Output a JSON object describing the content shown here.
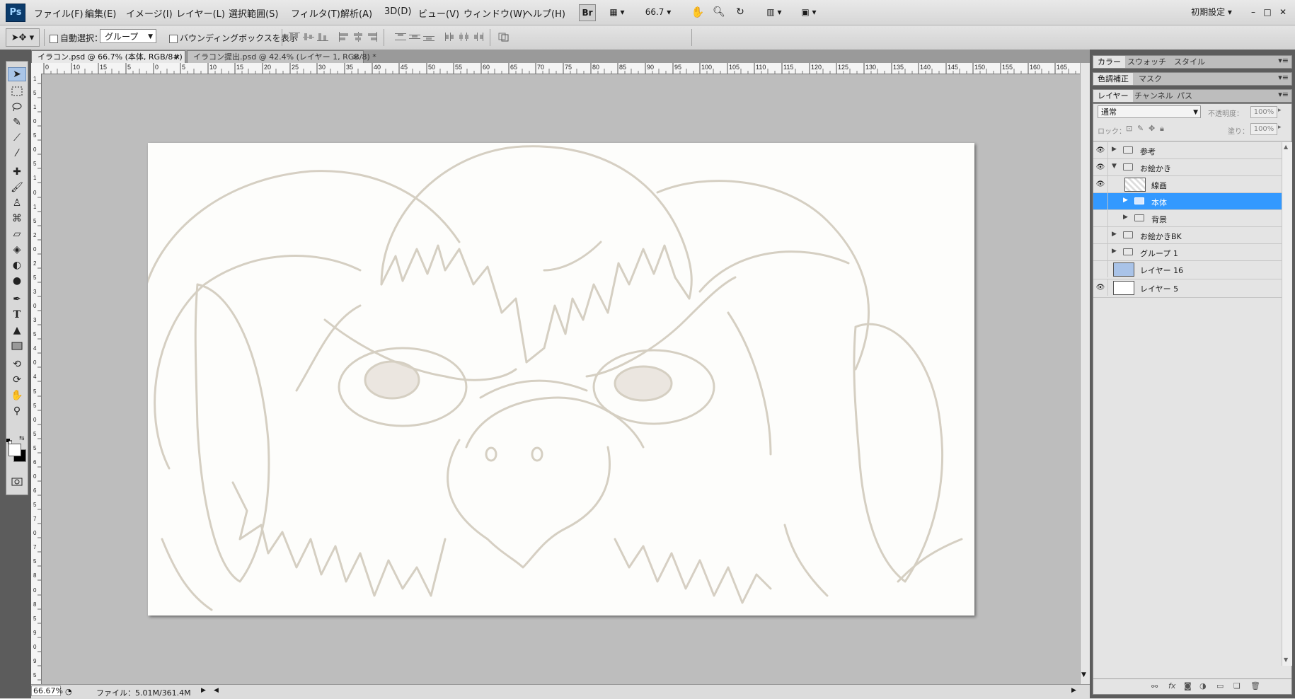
{
  "app": {
    "logo": "Ps",
    "workspace": "初期設定"
  },
  "menu": [
    "ファイル(F)",
    "編集(E)",
    "イメージ(I)",
    "レイヤー(L)",
    "選択範囲(S)",
    "フィルタ(T)",
    "解析(A)",
    "3D(D)",
    "ビュー(V)",
    "ウィンドウ(W)",
    "ヘルプ(H)"
  ],
  "appbar": {
    "bridge": "Br",
    "zoom": "66.7"
  },
  "options": {
    "auto_select": "自動選択：",
    "auto_select_value": "グループ",
    "show_bbox": "バウンディングボックスを表示"
  },
  "tabs": [
    {
      "label": "イラコン.psd @ 66.7% (本体, RGB/8#)",
      "close": "×"
    },
    {
      "label": "イラコン提出.psd @ 42.4% (レイヤー 1, RGB/8) *",
      "close": "×"
    }
  ],
  "ruler_h": [
    "0",
    "10",
    "15",
    "5",
    "0",
    "5",
    "10",
    "15",
    "20",
    "25",
    "30",
    "35",
    "40",
    "45",
    "50",
    "55",
    "60",
    "65",
    "70",
    "75",
    "80",
    "85",
    "90",
    "95",
    "100",
    "105",
    "110",
    "115",
    "120",
    "125",
    "130",
    "135",
    "140",
    "145",
    "150",
    "155",
    "160",
    "165"
  ],
  "ruler_v": [
    "1",
    "5",
    "1",
    "0",
    "5",
    "0",
    "5",
    "1",
    "0",
    "1",
    "5",
    "2",
    "0",
    "2",
    "5",
    "3",
    "0",
    "3",
    "5",
    "4",
    "0",
    "4",
    "5",
    "5",
    "0",
    "5",
    "5",
    "6",
    "0",
    "6",
    "5",
    "7",
    "0",
    "7",
    "5",
    "8",
    "0",
    "8",
    "5",
    "9",
    "0",
    "9",
    "5"
  ],
  "status": {
    "zoom": "66.67%",
    "file": "ファイル：5.01M/361.4M"
  },
  "panels": {
    "top_tabs": [
      "カラー",
      "スウォッチ",
      "スタイル"
    ],
    "adj_tabs": [
      "色調補正",
      "マスク"
    ],
    "layer_tabs": [
      "レイヤー",
      "チャンネル",
      "パス"
    ],
    "blend_mode": "通常",
    "opacity_label": "不透明度：",
    "opacity_value": "100%",
    "lock_label": "ロック：",
    "fill_label": "塗り：",
    "fill_value": "100%",
    "layers": [
      {
        "name": "参考",
        "visible": true,
        "type": "group",
        "expanded": false,
        "indent": 0
      },
      {
        "name": "お絵かき",
        "visible": true,
        "type": "group",
        "expanded": true,
        "indent": 0
      },
      {
        "name": "線画",
        "visible": true,
        "type": "layer",
        "indent": 1
      },
      {
        "name": "本体",
        "visible": false,
        "type": "group",
        "expanded": false,
        "indent": 1,
        "selected": true
      },
      {
        "name": "背景",
        "visible": false,
        "type": "group",
        "expanded": false,
        "indent": 1
      },
      {
        "name": "お絵かきBK",
        "visible": false,
        "type": "group",
        "expanded": false,
        "indent": 0
      },
      {
        "name": "グループ 1",
        "visible": false,
        "type": "group",
        "expanded": false,
        "indent": 0
      },
      {
        "name": "レイヤー 16",
        "visible": false,
        "type": "layer",
        "indent": 0,
        "thumb_color": "#a9c3e8"
      },
      {
        "name": "レイヤー 5",
        "visible": true,
        "type": "layer",
        "indent": 0,
        "thumb_color": "#ffffff"
      }
    ]
  },
  "colors": {
    "selection": "#3399ff",
    "pasteboard": "#bdbdbd",
    "sketch": "#c9c1b2"
  }
}
